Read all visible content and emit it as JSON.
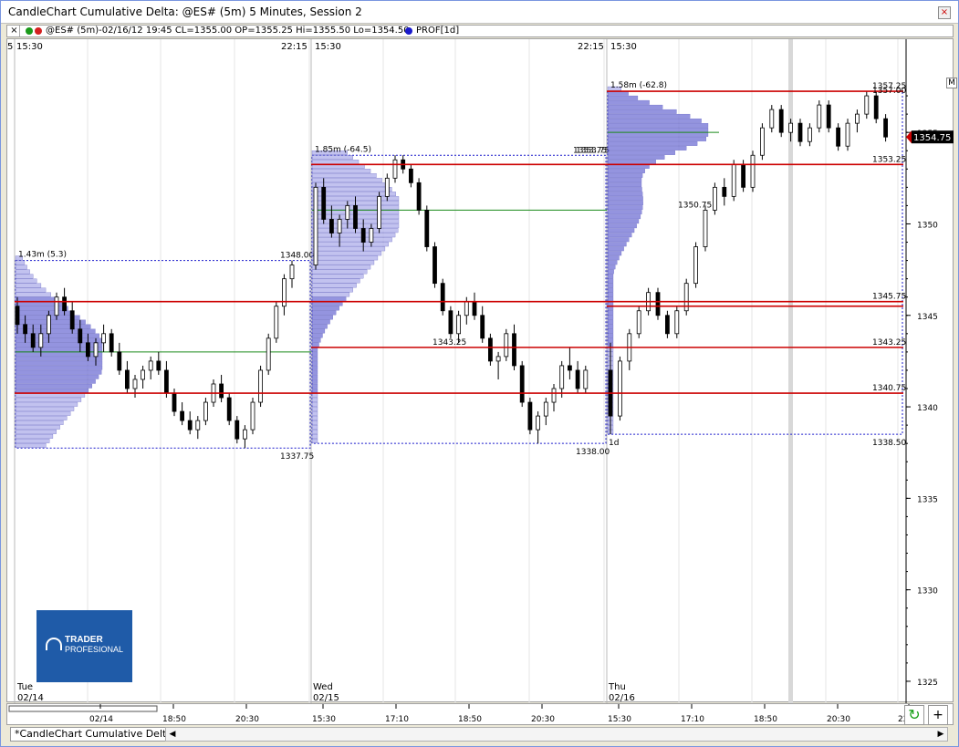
{
  "window": {
    "title": "CandleChart Cumulative Delta: @ES# (5m) 5 Minutes, Session 2",
    "close_glyph": "×"
  },
  "infobar": {
    "close_glyph": "×",
    "quote": "@ES# (5m)-02/16/12 19:45 CL=1355.00 OP=1355.25 Hi=1355.50 Lo=1354.50",
    "profile": "PROF[1d]",
    "dot_colors": [
      "#1a9a1a",
      "#d42020",
      "#1a1acc"
    ]
  },
  "m_button": "M",
  "logo": {
    "line1": "TRADER",
    "line2": "PROFESIONAL"
  },
  "tab": {
    "label": "*CandleChart Cumulative Delta"
  },
  "buttons": {
    "refresh": "↻",
    "plus": "+"
  },
  "scroll": {
    "left": "◀",
    "right": "▶"
  },
  "colors": {
    "red_level": "#cc0000",
    "green_poc": "#1a8a1a",
    "profile_fill": "#7a7ad8",
    "profile_dark": "#3a3ab0",
    "candle_up": "#ffffff",
    "candle_down": "#000000",
    "last_price_bg": "#000000"
  },
  "chart_data": {
    "type": "candlestick",
    "y_axis": {
      "ticks": [
        1325,
        1330,
        1335,
        1340,
        1345,
        1350,
        1355
      ]
    },
    "last_price": "1354.75",
    "top_session_labels": [
      "15:30",
      "22:15",
      "15:30",
      "22:15",
      "15:30"
    ],
    "top_edge_labels": [
      "5"
    ],
    "day_labels": [
      {
        "day": "Tue",
        "date": "02/14"
      },
      {
        "day": "Wed",
        "date": "02/15"
      },
      {
        "day": "Thu",
        "date": "02/16"
      }
    ],
    "time_ticks": [
      "02/14",
      "18:50",
      "20:30",
      "15:30",
      "17:10",
      "18:50",
      "20:30",
      "15:30",
      "17:10",
      "18:50",
      "20:30",
      "22:"
    ],
    "red_levels": [
      1357.25,
      1353.25,
      1345.75,
      1345.5,
      1343.25,
      1340.75
    ],
    "sessions": [
      {
        "header": "1.43m (5.3)",
        "high_label": "1348.00",
        "low_label": "1337.75",
        "high": 1348.0,
        "low": 1337.75,
        "poc": 1343.0,
        "vah": 1345.75,
        "val": 1340.75,
        "candles": [
          [
            1345.5,
            1346,
            1344,
            1344.5
          ],
          [
            1344.5,
            1345,
            1343.5,
            1344
          ],
          [
            1344,
            1344.5,
            1343,
            1343.25
          ],
          [
            1343.25,
            1344.5,
            1342.75,
            1344
          ],
          [
            1344,
            1345.25,
            1343.5,
            1345
          ],
          [
            1345,
            1346.25,
            1344.75,
            1346
          ],
          [
            1346,
            1346.5,
            1345,
            1345.25
          ],
          [
            1345.25,
            1345.75,
            1344,
            1344.25
          ],
          [
            1344.25,
            1344.75,
            1343,
            1343.5
          ],
          [
            1343.5,
            1344,
            1342.5,
            1342.75
          ],
          [
            1342.75,
            1343.75,
            1342.25,
            1343.5
          ],
          [
            1343.5,
            1344.5,
            1343,
            1344
          ],
          [
            1344,
            1344.25,
            1342.75,
            1343
          ],
          [
            1343,
            1343.5,
            1341.75,
            1342
          ],
          [
            1342,
            1342.5,
            1340.75,
            1341
          ],
          [
            1341,
            1341.75,
            1340.5,
            1341.5
          ],
          [
            1341.5,
            1342.25,
            1341,
            1342
          ],
          [
            1342,
            1342.75,
            1341.5,
            1342.5
          ],
          [
            1342.5,
            1343,
            1341.75,
            1342
          ],
          [
            1342,
            1342.5,
            1340.5,
            1340.75
          ],
          [
            1340.75,
            1341,
            1339.5,
            1339.75
          ],
          [
            1339.75,
            1340.25,
            1339,
            1339.25
          ],
          [
            1339.25,
            1339.75,
            1338.5,
            1338.75
          ],
          [
            1338.75,
            1339.5,
            1338.25,
            1339.25
          ],
          [
            1339.25,
            1340.5,
            1339,
            1340.25
          ],
          [
            1340.25,
            1341.5,
            1340,
            1341.25
          ],
          [
            1341.25,
            1341.75,
            1340.25,
            1340.5
          ],
          [
            1340.5,
            1340.75,
            1339,
            1339.25
          ],
          [
            1339.25,
            1339.5,
            1338,
            1338.25
          ],
          [
            1338.25,
            1339,
            1337.75,
            1338.75
          ],
          [
            1338.75,
            1340.5,
            1338.5,
            1340.25
          ],
          [
            1340.25,
            1342.25,
            1340,
            1342
          ],
          [
            1342,
            1344,
            1341.75,
            1343.75
          ],
          [
            1343.75,
            1345.75,
            1343.5,
            1345.5
          ],
          [
            1345.5,
            1347.25,
            1345,
            1347
          ],
          [
            1347,
            1348,
            1346.5,
            1347.75
          ]
        ]
      },
      {
        "header": "1.85m (-64.5)",
        "high_label": "1353.75",
        "low_label": "1338.00",
        "high": 1353.75,
        "low": 1338.0,
        "poc": 1350.75,
        "vah": 1345.75,
        "val": 1340.75,
        "candles": [
          [
            1347.75,
            1352.25,
            1347.5,
            1352
          ],
          [
            1352,
            1352.5,
            1350,
            1350.25
          ],
          [
            1350.25,
            1351,
            1349.25,
            1349.5
          ],
          [
            1349.5,
            1350.5,
            1348.75,
            1350.25
          ],
          [
            1350.25,
            1351.25,
            1349.75,
            1351
          ],
          [
            1351,
            1351.5,
            1349.5,
            1349.75
          ],
          [
            1349.75,
            1350.25,
            1348.5,
            1349
          ],
          [
            1349,
            1350,
            1348.75,
            1349.75
          ],
          [
            1349.75,
            1351.75,
            1349.5,
            1351.5
          ],
          [
            1351.5,
            1352.75,
            1351.25,
            1352.5
          ],
          [
            1352.5,
            1353.75,
            1352.25,
            1353.5
          ],
          [
            1353.5,
            1353.75,
            1352.75,
            1353
          ],
          [
            1353,
            1353.25,
            1352,
            1352.25
          ],
          [
            1352.25,
            1352.5,
            1350.5,
            1350.75
          ],
          [
            1350.75,
            1351,
            1348.5,
            1348.75
          ],
          [
            1348.75,
            1349,
            1346.5,
            1346.75
          ],
          [
            1346.75,
            1347,
            1345,
            1345.25
          ],
          [
            1345.25,
            1345.5,
            1343.75,
            1344
          ],
          [
            1344,
            1345.25,
            1343.5,
            1345
          ],
          [
            1345,
            1346,
            1344.5,
            1345.75
          ],
          [
            1345.75,
            1346.25,
            1344.75,
            1345
          ],
          [
            1345,
            1345.5,
            1343.5,
            1343.75
          ],
          [
            1343.75,
            1344,
            1342.25,
            1342.5
          ],
          [
            1342.5,
            1343,
            1341.5,
            1342.75
          ],
          [
            1342.75,
            1344.25,
            1342.5,
            1344
          ],
          [
            1344,
            1344.5,
            1342,
            1342.25
          ],
          [
            1342.25,
            1342.5,
            1340,
            1340.25
          ],
          [
            1340.25,
            1340.5,
            1338.5,
            1338.75
          ],
          [
            1338.75,
            1339.75,
            1338,
            1339.5
          ],
          [
            1339.5,
            1340.5,
            1339,
            1340.25
          ],
          [
            1340.25,
            1341.25,
            1339.75,
            1341
          ],
          [
            1341,
            1342.5,
            1340.5,
            1342.25
          ],
          [
            1342.25,
            1343.25,
            1341.5,
            1342
          ],
          [
            1342,
            1342.5,
            1340.75,
            1341
          ],
          [
            1341,
            1342.25,
            1340.75,
            1342
          ]
        ]
      },
      {
        "header": "1.58m (-62.8)",
        "high_label": "1357.25",
        "low_label": "1338.50",
        "period_label": "1d",
        "high": 1357.25,
        "low": 1338.5,
        "poc": 1355.0,
        "vah": 1357.0,
        "val": 1343.25,
        "candles": [
          [
            1342,
            1343.5,
            1338.5,
            1339.5
          ],
          [
            1339.5,
            1342.75,
            1339.25,
            1342.5
          ],
          [
            1342.5,
            1344.25,
            1342,
            1344
          ],
          [
            1344,
            1345.5,
            1343.75,
            1345.25
          ],
          [
            1345.25,
            1346.5,
            1345,
            1346.25
          ],
          [
            1346.25,
            1346.5,
            1344.75,
            1345
          ],
          [
            1345,
            1345.25,
            1343.75,
            1344
          ],
          [
            1344,
            1345.5,
            1343.75,
            1345.25
          ],
          [
            1345.25,
            1347,
            1345,
            1346.75
          ],
          [
            1346.75,
            1349,
            1346.5,
            1348.75
          ],
          [
            1348.75,
            1351,
            1348.5,
            1350.75
          ],
          [
            1350.75,
            1352.25,
            1350.5,
            1352
          ],
          [
            1352,
            1352.5,
            1351,
            1351.5
          ],
          [
            1351.5,
            1353.5,
            1351.25,
            1353.25
          ],
          [
            1353.25,
            1353.5,
            1351.75,
            1352
          ],
          [
            1352,
            1354,
            1351.75,
            1353.75
          ],
          [
            1353.75,
            1355.5,
            1353.5,
            1355.25
          ],
          [
            1355.25,
            1356.5,
            1355,
            1356.25
          ],
          [
            1356.25,
            1356.5,
            1354.75,
            1355
          ],
          [
            1355,
            1355.75,
            1354.5,
            1355.5
          ],
          [
            1355.5,
            1355.75,
            1354.25,
            1354.5
          ],
          [
            1354.5,
            1355.5,
            1354.25,
            1355.25
          ],
          [
            1355.25,
            1356.75,
            1355,
            1356.5
          ],
          [
            1356.5,
            1356.75,
            1355,
            1355.25
          ],
          [
            1355.25,
            1355.5,
            1354,
            1354.25
          ],
          [
            1354.25,
            1355.75,
            1354,
            1355.5
          ],
          [
            1355.5,
            1356.25,
            1355,
            1356
          ],
          [
            1356,
            1357.25,
            1355.75,
            1357
          ],
          [
            1357,
            1357.25,
            1355.5,
            1355.75
          ],
          [
            1355.75,
            1356,
            1354.5,
            1354.75
          ]
        ]
      }
    ]
  }
}
